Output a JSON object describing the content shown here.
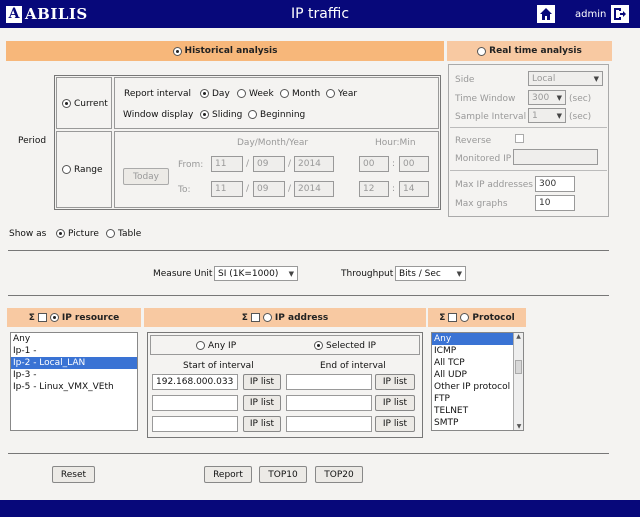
{
  "header": {
    "logo_letter": "A",
    "logo_text": "ABILIS",
    "title": "IP traffic",
    "user": "admin"
  },
  "tabs": {
    "historical": "Historical analysis",
    "realtime": "Real time analysis"
  },
  "period": {
    "label": "Period",
    "current": "Current",
    "range": "Range",
    "report_interval_label": "Report interval",
    "intervals": [
      "Day",
      "Week",
      "Month",
      "Year"
    ],
    "window_display_label": "Window display",
    "window_options": [
      "Sliding",
      "Beginning"
    ],
    "today_button": "Today",
    "date_header": "Day/Month/Year",
    "time_header": "Hour:Min",
    "from_label": "From:",
    "to_label": "To:",
    "from": {
      "day": "11",
      "month": "09",
      "year": "2014",
      "hour": "00",
      "min": "00"
    },
    "to": {
      "day": "11",
      "month": "09",
      "year": "2014",
      "hour": "12",
      "min": "14"
    },
    "slash": "/",
    "colon": ":"
  },
  "realtime": {
    "side_label": "Side",
    "side_value": "Local",
    "window_label": "Time Window",
    "window_value": "300",
    "window_unit": "(sec)",
    "sample_label": "Sample Interval",
    "sample_value": "1",
    "sample_unit": "(sec)",
    "reverse_label": "Reverse",
    "monitored_label": "Monitored IP",
    "max_ip_label": "Max IP addresses",
    "max_ip_value": "300",
    "max_graphs_label": "Max graphs",
    "max_graphs_value": "10"
  },
  "show_as": {
    "label": "Show as",
    "picture": "Picture",
    "table": "Table"
  },
  "measure": {
    "unit_label": "Measure Unit",
    "unit_value": "SI (1K=1000)",
    "throughput_label": "Throughput",
    "throughput_value": "Bits / Sec"
  },
  "ip_resource": {
    "sigma": "Σ",
    "title": "IP resource",
    "items": [
      "Any",
      "Ip-1 -",
      "Ip-2 - Local_LAN",
      "Ip-3 -",
      "Ip-5 - Linux_VMX_VEth"
    ],
    "selected_index": 2
  },
  "ip_address": {
    "sigma": "Σ",
    "title": "IP address",
    "any": "Any IP",
    "selected": "Selected IP",
    "start_header": "Start of interval",
    "end_header": "End of interval",
    "ip_list_button": "IP list",
    "rows": [
      {
        "start": "192.168.000.033",
        "end": ""
      },
      {
        "start": "",
        "end": ""
      },
      {
        "start": "",
        "end": ""
      }
    ]
  },
  "protocol": {
    "sigma": "Σ",
    "title": "Protocol",
    "items": [
      "Any",
      "ICMP",
      "All TCP",
      "All UDP",
      "Other IP protocol",
      "FTP",
      "TELNET",
      "SMTP"
    ],
    "selected_index": 0
  },
  "buttons": {
    "reset": "Reset",
    "report": "Report",
    "top10": "TOP10",
    "top20": "TOP20"
  }
}
